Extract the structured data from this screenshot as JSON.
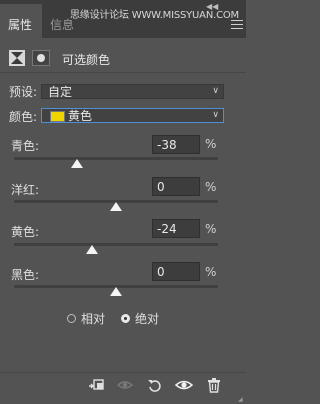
{
  "tabs": [
    {
      "label": "属性"
    },
    {
      "label": "信息"
    }
  ],
  "watermark": "思缘设计论坛 WWW.MISSYUAN.COM",
  "panel": {
    "title": "可选颜色"
  },
  "preset": {
    "label": "预设:",
    "value": "自定"
  },
  "color": {
    "label": "颜色:",
    "value": "黄色",
    "swatch_color": "#f0d400"
  },
  "sliders": [
    {
      "label": "青色:",
      "value": "-38",
      "unit": "%",
      "fraction": 0.31
    },
    {
      "label": "洋红:",
      "value": "0",
      "unit": "%",
      "fraction": 0.5
    },
    {
      "label": "黄色:",
      "value": "-24",
      "unit": "%",
      "fraction": 0.38
    },
    {
      "label": "黑色:",
      "value": "0",
      "unit": "%",
      "fraction": 0.5
    }
  ],
  "method": {
    "options": [
      {
        "label": "相对"
      },
      {
        "label": "绝对"
      }
    ],
    "selected": "绝对"
  },
  "icons": [
    "clip-to-layer-icon",
    "view-previous-icon",
    "reset-icon",
    "visibility-eye-icon",
    "trash-icon"
  ]
}
